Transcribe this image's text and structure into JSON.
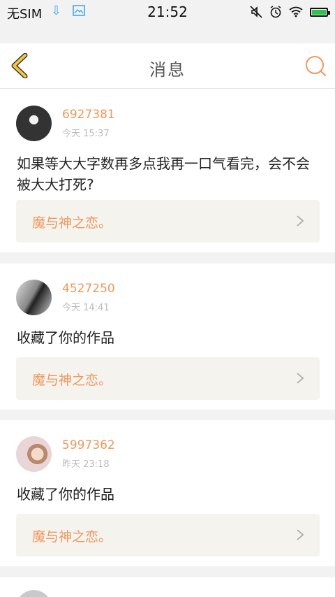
{
  "status_bar": {
    "carrier": "无SIM",
    "time": "21:52"
  },
  "header": {
    "title": "消息"
  },
  "messages": [
    {
      "username": "6927381",
      "time": "今天 15:37",
      "text": "如果等大大字数再多点我再一口气看完，会不会被大大打死?",
      "work": "魔与神之恋。"
    },
    {
      "username": "4527250",
      "time": "今天 14:41",
      "text": "收藏了你的作品",
      "work": "魔与神之恋。"
    },
    {
      "username": "5997362",
      "time": "昨天 23:18",
      "text": "收藏了你的作品",
      "work": "魔与神之恋。"
    }
  ],
  "colors": {
    "accent": "#f0975d",
    "back_arrow": "#f5c542",
    "battery": "#2dc24a"
  }
}
